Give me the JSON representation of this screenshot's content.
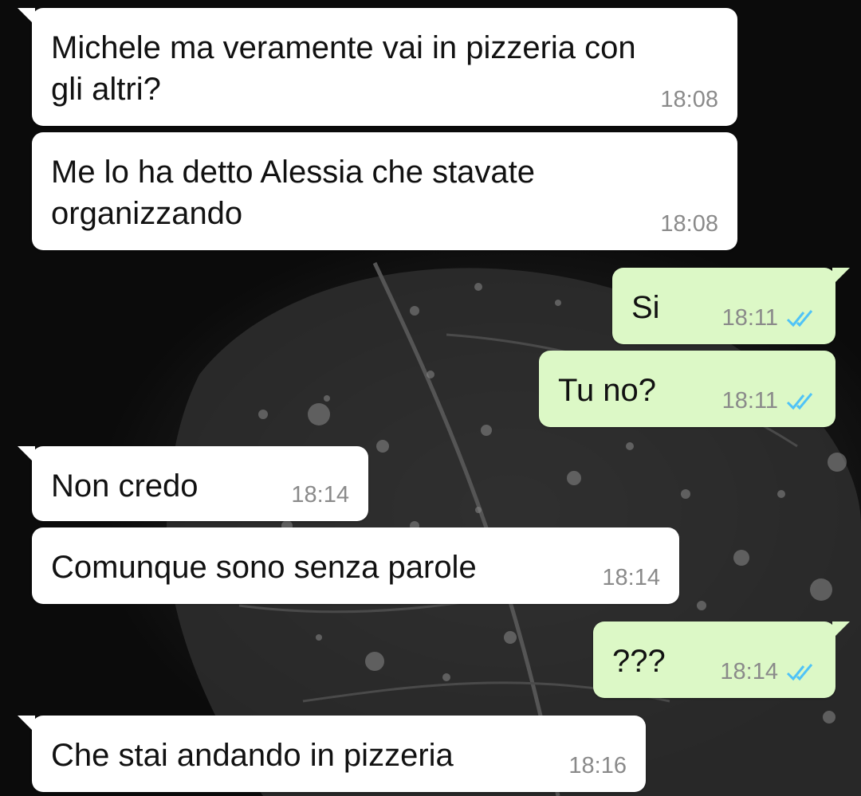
{
  "theme": {
    "incoming_bubble": "#ffffff",
    "outgoing_bubble": "#dcf8c6",
    "read_ticks": "#4fc3f7",
    "timestamp": "#8a8a8a"
  },
  "messages": [
    {
      "direction": "incoming",
      "text": "Michele ma veramente vai in pizzeria con\ngli altri?",
      "time": "18:08"
    },
    {
      "direction": "incoming",
      "text": "Me lo ha detto Alessia che stavate\norganizzando",
      "time": "18:08"
    },
    {
      "direction": "outgoing",
      "text": "Si",
      "time": "18:11",
      "status_icon": "double-check-read-icon"
    },
    {
      "direction": "outgoing",
      "text": "Tu no?",
      "time": "18:11",
      "status_icon": "double-check-read-icon"
    },
    {
      "direction": "incoming",
      "text": "Non credo",
      "time": "18:14"
    },
    {
      "direction": "incoming",
      "text": "Comunque sono senza parole",
      "time": "18:14"
    },
    {
      "direction": "outgoing",
      "text": "???",
      "time": "18:14",
      "status_icon": "double-check-read-icon"
    },
    {
      "direction": "incoming",
      "text": "Che stai andando in pizzeria",
      "time": "18:16"
    }
  ]
}
